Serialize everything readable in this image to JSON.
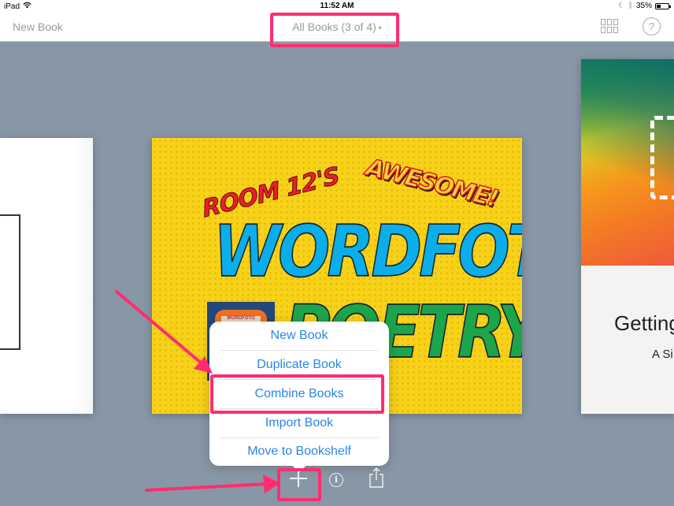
{
  "status_bar": {
    "device": "iPad",
    "time": "11:52 AM",
    "battery_percent": "35%",
    "battery_level": 0.35
  },
  "nav": {
    "left_button": "New Book",
    "title": "All Books (3 of 4)",
    "title_caret": "▾",
    "help_label": "?"
  },
  "books": {
    "center": {
      "line1": "ROOM 12'S",
      "line2": "AWESOME!",
      "line3": "WORDFOTO",
      "line4": "POETRY",
      "thumb_label": "WORDFOTO"
    },
    "right": {
      "title": "Getting",
      "subtitle": "A Si"
    }
  },
  "popover": {
    "items": [
      {
        "label": "New Book"
      },
      {
        "label": "Duplicate Book"
      },
      {
        "label": "Combine Books"
      },
      {
        "label": "Import Book"
      },
      {
        "label": "Move to Bookshelf"
      }
    ]
  },
  "toolbar": {
    "info_label": "i"
  },
  "annotation_color": "#ff2d6e",
  "accent_color": "#2a86e8"
}
